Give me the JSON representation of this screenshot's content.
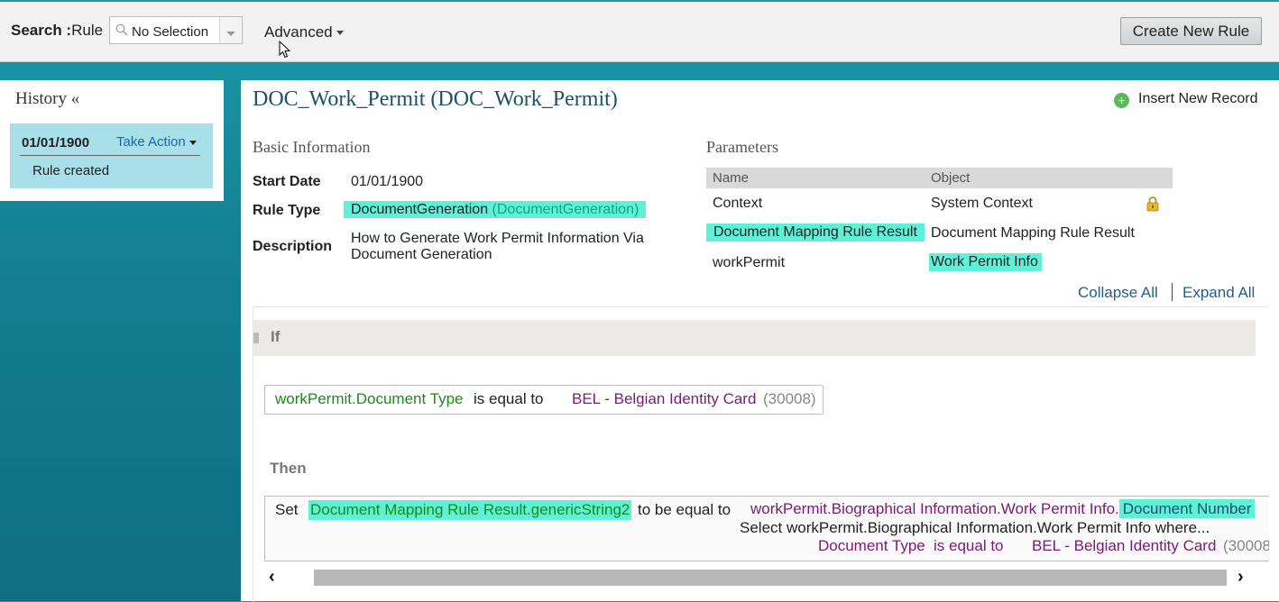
{
  "topbar": {
    "search_label": "Search :",
    "search_type": "Rule",
    "search_value": "No Selection",
    "advanced_label": "Advanced",
    "create_button": "Create New Rule"
  },
  "history": {
    "title": "History «",
    "entries": [
      {
        "date": "01/01/1900",
        "action": "Take Action",
        "message": "Rule created"
      }
    ]
  },
  "rule": {
    "title": "DOC_Work_Permit (DOC_Work_Permit)",
    "insert_record": "Insert New Record",
    "basic_info_title": "Basic Information",
    "start_date_label": "Start Date",
    "start_date": "01/01/1900",
    "rule_type_label": "Rule Type",
    "rule_type": "DocumentGeneration",
    "rule_type_code": "(DocumentGeneration)",
    "description_label": "Description",
    "description": "How to Generate Work Permit Information Via Document Generation",
    "parameters_title": "Parameters",
    "param_headers": {
      "name": "Name",
      "object": "Object"
    },
    "params": [
      {
        "name": "Context",
        "object": "System Context"
      },
      {
        "name": "Document Mapping Rule Result",
        "object": "Document Mapping Rule Result"
      },
      {
        "name": "workPermit",
        "object": "Work Permit Info"
      }
    ],
    "collapse_all": "Collapse All",
    "expand_all": "Expand All",
    "if_label": "If",
    "condition": {
      "field": "workPermit.Document Type",
      "operator": "is equal to",
      "value": "BEL - Belgian Identity Card",
      "code": "(30008)"
    },
    "then_label": "Then",
    "action": {
      "verb": "Set",
      "target": "Document Mapping Rule Result.genericString2",
      "op": "to be equal to",
      "source_path": "workPermit.Biographical Information.Work Permit Info.",
      "source_field": "Document Number",
      "select_line": "Select workPermit.Biographical Information.Work Permit Info where...",
      "where_field": "Document Type",
      "where_op": "is equal to",
      "where_value": "BEL - Belgian Identity Card",
      "where_code": "(30008"
    }
  }
}
